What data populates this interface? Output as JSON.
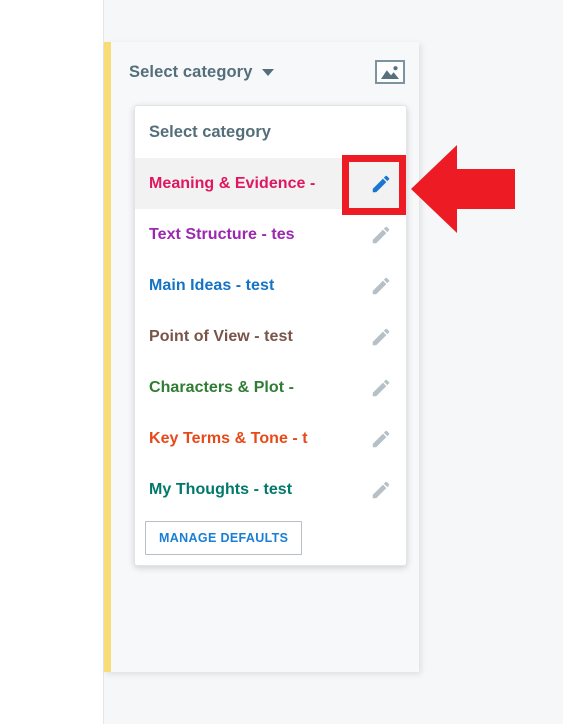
{
  "header": {
    "title": "Select category",
    "caret_icon": "chevron-down-icon",
    "image_icon": "image-placeholder-icon",
    "title_color": "#546e7a"
  },
  "dropdown": {
    "heading": "Select category",
    "items": [
      {
        "label": "Meaning & Evidence -",
        "color": "#e01760",
        "edit_icon": "pencil-icon",
        "edit_icon_color": "#1976d2",
        "hovered": true,
        "highlighted": true
      },
      {
        "label": "Text Structure - tes",
        "color": "#9c27b0",
        "edit_icon": "pencil-icon",
        "edit_icon_color": "#b5c0c7",
        "hovered": false,
        "highlighted": false
      },
      {
        "label": "Main Ideas - test",
        "color": "#1573c6",
        "edit_icon": "pencil-icon",
        "edit_icon_color": "#b5c0c7",
        "hovered": false,
        "highlighted": false
      },
      {
        "label": "Point of View - test",
        "color": "#795548",
        "edit_icon": "pencil-icon",
        "edit_icon_color": "#b5c0c7",
        "hovered": false,
        "highlighted": false
      },
      {
        "label": "Characters & Plot -",
        "color": "#2e7d32",
        "edit_icon": "pencil-icon",
        "edit_icon_color": "#b5c0c7",
        "hovered": false,
        "highlighted": false
      },
      {
        "label": "Key Terms & Tone - t",
        "color": "#e64a19",
        "edit_icon": "pencil-icon",
        "edit_icon_color": "#b5c0c7",
        "hovered": false,
        "highlighted": false
      },
      {
        "label": "My Thoughts - test",
        "color": "#00796b",
        "edit_icon": "pencil-icon",
        "edit_icon_color": "#b5c0c7",
        "hovered": false,
        "highlighted": false
      }
    ],
    "manage_defaults_label": "MANAGE DEFAULTS",
    "manage_defaults_color": "#1a7fd4"
  },
  "annotation": {
    "highlight_color": "#ed1c24",
    "arrow_color": "#ed1c24",
    "arrow_direction": "left",
    "target": "edit-pencil-of-meaning-and-evidence"
  },
  "theme": {
    "card_accent_bar": "#f8dd76",
    "page_background": "#f6f7f9",
    "card_background": "#f7f8fa",
    "hover_row_background": "#f2f2f2"
  }
}
